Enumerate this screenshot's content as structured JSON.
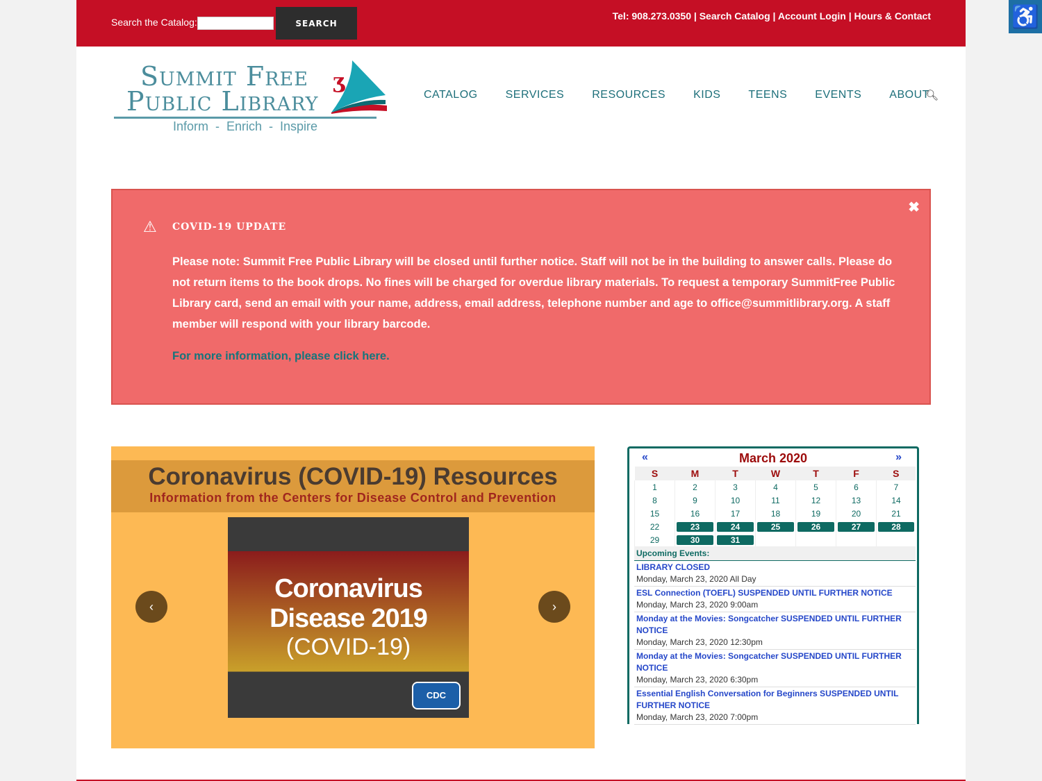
{
  "topbar": {
    "search_label": "Search the Catalog:",
    "search_value": "",
    "search_button": "SEARCH",
    "links": [
      "Tel: 908.273.0350",
      "Search Catalog",
      "Account Login",
      "Hours & Contact"
    ],
    "separator": " | "
  },
  "accessibility_icon": "wheelchair-icon",
  "logo": {
    "line1": "Summit Free",
    "line2": "Public Library",
    "tagline": "Inform  -  Enrich  -  Inspire"
  },
  "nav": {
    "items": [
      "CATALOG",
      "SERVICES",
      "RESOURCES",
      "KIDS",
      "TEENS",
      "EVENTS",
      "ABOUT"
    ],
    "search_icon": "search-icon"
  },
  "alert": {
    "title": "COVID-19 UPDATE",
    "message": "Please note: Summit Free Public Library will be closed until further notice. Staff will not be in the building to answer calls. Please do not return items to the book drops. No fines will be charged for overdue library materials. To request a temporary SummitFree Public Library card, send an email with your name, address, email address, telephone number and age to office@summitlibrary.org. A staff member will respond with your library barcode.",
    "link": "For more information, please click here.",
    "close": "✖",
    "icon": "warning-icon"
  },
  "slider": {
    "heading": "Coronavirus (COVID-19) Resources",
    "subheading": "Information from the Centers for Disease Control and Prevention",
    "image_line1": "Coronavirus",
    "image_line2": "Disease 2019",
    "image_line3": "(COVID-19)",
    "image_badge": "CDC",
    "prev": "‹",
    "next": "›"
  },
  "calendar": {
    "month": "March 2020",
    "prev": "«",
    "next": "»",
    "weekdays": [
      "S",
      "M",
      "T",
      "W",
      "T",
      "F",
      "S"
    ],
    "weeks": [
      [
        "1",
        "2",
        "3",
        "4",
        "5",
        "6",
        "7"
      ],
      [
        "8",
        "9",
        "10",
        "11",
        "12",
        "13",
        "14"
      ],
      [
        "15",
        "16",
        "17",
        "18",
        "19",
        "20",
        "21"
      ],
      [
        "22",
        "23",
        "24",
        "25",
        "26",
        "27",
        "28"
      ],
      [
        "29",
        "30",
        "31",
        "",
        "",
        "",
        ""
      ]
    ],
    "event_days": [
      "23",
      "24",
      "25",
      "26",
      "27",
      "28",
      "30",
      "31"
    ],
    "upcoming_label": "Upcoming Events:",
    "events": [
      {
        "name": "LIBRARY CLOSED",
        "date": "Monday, March 23, 2020 All Day"
      },
      {
        "name": "ESL Connection (TOEFL) SUSPENDED UNTIL FURTHER NOTICE",
        "date": "Monday, March 23, 2020 9:00am"
      },
      {
        "name": "Monday at the Movies: Songcatcher SUSPENDED UNTIL FURTHER NOTICE",
        "date": "Monday, March 23, 2020 12:30pm"
      },
      {
        "name": "Monday at the Movies: Songcatcher SUSPENDED UNTIL FURTHER NOTICE",
        "date": "Monday, March 23, 2020 6:30pm"
      },
      {
        "name": "Essential English Conversation for Beginners SUSPENDED UNTIL FURTHER NOTICE",
        "date": "Monday, March 23, 2020 7:00pm"
      }
    ]
  },
  "colors": {
    "brand_red": "#c50f25",
    "teal": "#0e6a62",
    "alert_bg": "#f06a6a",
    "slider_bg": "#fdb954"
  }
}
